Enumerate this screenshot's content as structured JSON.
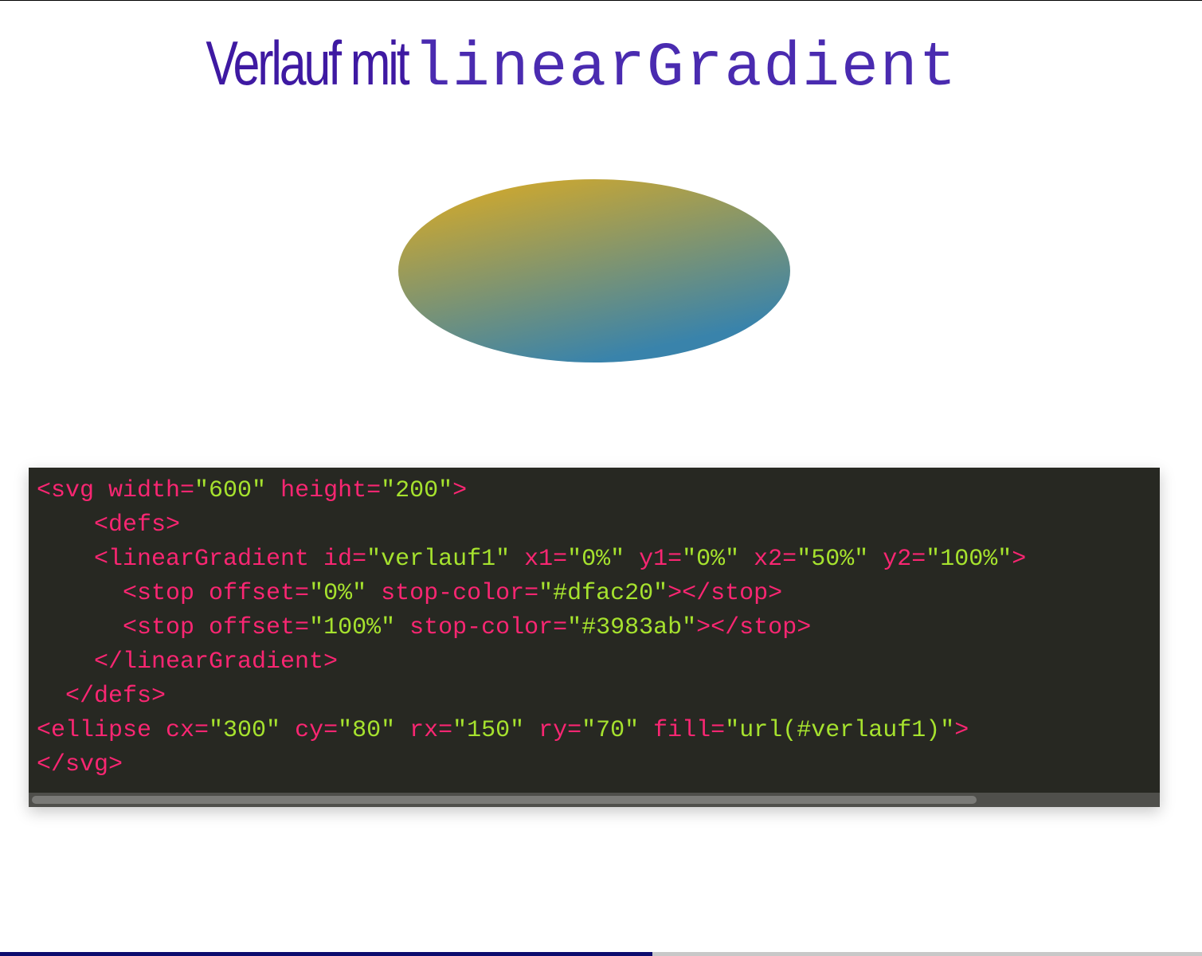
{
  "slide": {
    "title_text": "Verlauf mit",
    "title_code": "linearGradient",
    "title_color": "#3e19a2"
  },
  "demo": {
    "gradient_stop_start": "#dfac20",
    "gradient_stop_end": "#3983ab"
  },
  "code": {
    "lines": [
      [
        {
          "t": "tag",
          "v": "<svg width="
        },
        {
          "t": "str",
          "v": "\"600\""
        },
        {
          "t": "tag",
          "v": " height="
        },
        {
          "t": "str",
          "v": "\"200\""
        },
        {
          "t": "tag",
          "v": ">"
        }
      ],
      [
        {
          "t": "tag",
          "v": "    <defs>"
        }
      ],
      [
        {
          "t": "tag",
          "v": "    <linearGradient id="
        },
        {
          "t": "str",
          "v": "\"verlauf1\""
        },
        {
          "t": "tag",
          "v": " x1="
        },
        {
          "t": "str",
          "v": "\"0%\""
        },
        {
          "t": "tag",
          "v": " y1="
        },
        {
          "t": "str",
          "v": "\"0%\""
        },
        {
          "t": "tag",
          "v": " x2="
        },
        {
          "t": "str",
          "v": "\"50%\""
        },
        {
          "t": "tag",
          "v": " y2="
        },
        {
          "t": "str",
          "v": "\"100%\""
        },
        {
          "t": "tag",
          "v": ">"
        }
      ],
      [
        {
          "t": "tag",
          "v": "      <stop offset="
        },
        {
          "t": "str",
          "v": "\"0%\""
        },
        {
          "t": "tag",
          "v": " stop-color="
        },
        {
          "t": "str",
          "v": "\"#dfac20\""
        },
        {
          "t": "tag",
          "v": "></stop>"
        }
      ],
      [
        {
          "t": "tag",
          "v": "      <stop offset="
        },
        {
          "t": "str",
          "v": "\"100%\""
        },
        {
          "t": "tag",
          "v": " stop-color="
        },
        {
          "t": "str",
          "v": "\"#3983ab\""
        },
        {
          "t": "tag",
          "v": "></stop>"
        }
      ],
      [
        {
          "t": "tag",
          "v": "    </linearGradient>"
        }
      ],
      [
        {
          "t": "tag",
          "v": "  </defs>"
        }
      ],
      [
        {
          "t": "tag",
          "v": "<ellipse cx="
        },
        {
          "t": "str",
          "v": "\"300\""
        },
        {
          "t": "tag",
          "v": " cy="
        },
        {
          "t": "str",
          "v": "\"80\""
        },
        {
          "t": "tag",
          "v": " rx="
        },
        {
          "t": "str",
          "v": "\"150\""
        },
        {
          "t": "tag",
          "v": " ry="
        },
        {
          "t": "str",
          "v": "\"70\""
        },
        {
          "t": "tag",
          "v": " fill="
        },
        {
          "t": "str",
          "v": "\"url(#verlauf1)\""
        },
        {
          "t": "tag",
          "v": ">"
        }
      ],
      [
        {
          "t": "tag",
          "v": "</svg>"
        }
      ]
    ],
    "colors": {
      "tag": "#f92672",
      "str": "#a6e22e",
      "background": "#272822"
    },
    "horizontal_scroll_fraction": 0.84
  },
  "presentation": {
    "progress_fraction": 0.543,
    "progress_color": "#0d0b6e"
  }
}
